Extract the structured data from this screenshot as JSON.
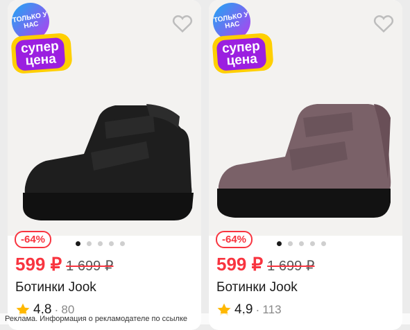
{
  "products": [
    {
      "badge_only": "ТОЛЬКО У НАС",
      "badge_super_1": "супер",
      "badge_super_2": "цена",
      "discount": "-64%",
      "price": "599 ₽",
      "old_price": "1 699 ₽",
      "title": "Ботинки Jook",
      "rating": "4,8",
      "reviews": "80",
      "shoe_color": "#1e1e1e",
      "image_dots": 5,
      "active_dot": 1
    },
    {
      "badge_only": "ТОЛЬКО У НАС",
      "badge_super_1": "супер",
      "badge_super_2": "цена",
      "discount": "-64%",
      "price": "599 ₽",
      "old_price": "1 699 ₽",
      "title": "Ботинки Jook",
      "rating": "4,9",
      "reviews": "113",
      "shoe_color": "#7a6168",
      "image_dots": 5,
      "active_dot": 1
    }
  ],
  "ad_notice": "Реклама. Информация о рекламодателе по ссылке",
  "colors": {
    "accent_red": "#f8343f",
    "badge_purple": "#9b1fe0",
    "badge_yellow": "#ffcf00",
    "star": "#ffb800"
  },
  "icons": [
    "heart-icon",
    "star-icon"
  ]
}
